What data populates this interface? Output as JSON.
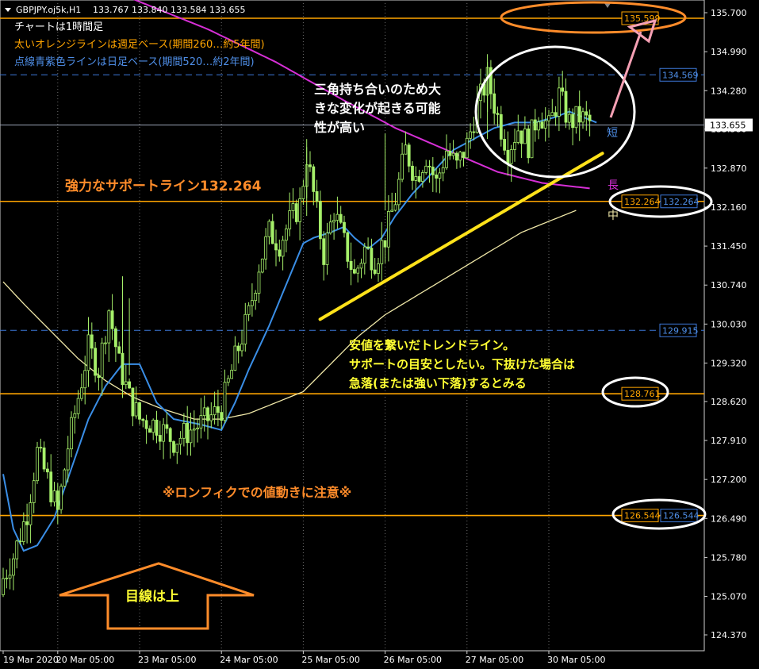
{
  "header": {
    "symbol": "GBPJPY.oj5k,H1",
    "ohlc": "133.767 133.840 133.584 133.655",
    "line1": "チャートは1時間足",
    "line2": "太いオレンジラインは週足ベース(期間260…約5年間)",
    "line3": "点線青紫色ラインは日足ベース(期間520…約2年間)"
  },
  "annotations": {
    "support": "強力なサポートライン132.264",
    "triangle": [
      "三角持ち合いのため大",
      "きな変化が起きる可能",
      "性が高い"
    ],
    "trend": [
      "安値を繋いだトレンドライン。",
      "サポートの目安としたい。下抜けた場合は",
      "急落(または強い下落)するとみる"
    ],
    "lonfix": "※ロンフィクでの値動きに注意※",
    "arrow": "目線は上",
    "ma_short": "短",
    "ma_long": "長",
    "ma_mid": "中"
  },
  "colors": {
    "background": "#000000",
    "orange": "#FFA500",
    "annotation_orange": "#FF8C2A",
    "dashed_blue": "#3C78D8",
    "candle": "#A6F06A",
    "ma_short": "#3A8EE6",
    "ma_mid": "#F0E8A8",
    "ma_long": "#D62FD6",
    "trendline": "#FFE21A",
    "text_yellow": "#FFFF33",
    "pink_arrow": "#F5A0B4",
    "circle_white": "#FFFFFF",
    "axis_text": "#FFFFFF",
    "current_price_bg": "#FFFFFF"
  },
  "chart_data": {
    "type": "candlestick",
    "timeframe": "H1",
    "y_axis": {
      "min": 124.0,
      "max": 135.8,
      "ticks": [
        124.37,
        125.07,
        125.78,
        126.49,
        127.2,
        127.91,
        128.62,
        129.32,
        130.03,
        130.74,
        131.45,
        132.16,
        132.87,
        133.58,
        134.28,
        134.99,
        135.7
      ],
      "tick_labels": [
        "124.370",
        "125.070",
        "125.780",
        "126.490",
        "127.200",
        "127.910",
        "128.620",
        "129.320",
        "130.030",
        "130.740",
        "131.450",
        "132.160",
        "132.870",
        "133.580",
        "134.280",
        "134.990",
        "135.700"
      ]
    },
    "x_axis": {
      "labels": [
        "19 Mar 2020",
        "20 Mar 05:00",
        "23 Mar 05:00",
        "24 Mar 05:00",
        "25 Mar 05:00",
        "26 Mar 05:00",
        "27 Mar 05:00",
        "30 Mar 05:00"
      ],
      "label_index": [
        0,
        16,
        40,
        64,
        88,
        112,
        136,
        160
      ]
    },
    "bar_count": 190,
    "current_price": 133.655,
    "current_price_label": "133.655",
    "horizontal_lines": [
      {
        "value": 135.599,
        "label": "135.599",
        "style": "solid",
        "color": "orange"
      },
      {
        "value": 134.569,
        "label": "134.569",
        "style": "dashed",
        "color": "blue"
      },
      {
        "value": 132.264,
        "label": "132.264",
        "style": "solid",
        "color": "orange"
      },
      {
        "value": 129.915,
        "label": "129.915",
        "style": "dashed",
        "color": "blue"
      },
      {
        "value": 128.761,
        "label": "128.761",
        "style": "solid",
        "color": "orange"
      },
      {
        "value": 126.544,
        "label": "126.544",
        "style": "solid",
        "color": "orange"
      }
    ],
    "price_tags": [
      {
        "value": 135.599,
        "text": "135.599",
        "kind": "orange"
      },
      {
        "value": 134.569,
        "text": "134.569",
        "kind": "blue"
      },
      {
        "value": 132.264,
        "text": "132.264",
        "kind": "orange"
      },
      {
        "value": 132.264,
        "text": "132.264",
        "kind": "blue-axis"
      },
      {
        "value": 129.915,
        "text": "129.915",
        "kind": "blue"
      },
      {
        "value": 128.761,
        "text": "128.761",
        "kind": "orange"
      },
      {
        "value": 126.544,
        "text": "126.544",
        "kind": "orange"
      },
      {
        "value": 126.544,
        "text": "126.544",
        "kind": "blue-axis"
      }
    ],
    "closes_anchor": [
      [
        0,
        125.4
      ],
      [
        3,
        125.8
      ],
      [
        7,
        126.6
      ],
      [
        10,
        127.7
      ],
      [
        13,
        127.2
      ],
      [
        16,
        126.6
      ],
      [
        19,
        127.8
      ],
      [
        22,
        128.7
      ],
      [
        25,
        129.6
      ],
      [
        28,
        129.2
      ],
      [
        31,
        130.3
      ],
      [
        34,
        129.3
      ],
      [
        37,
        128.7
      ],
      [
        40,
        128.3
      ],
      [
        45,
        128.2
      ],
      [
        50,
        127.9
      ],
      [
        55,
        128.1
      ],
      [
        60,
        128.3
      ],
      [
        64,
        128.5
      ],
      [
        68,
        129.4
      ],
      [
        72,
        130.2
      ],
      [
        75,
        131.1
      ],
      [
        78,
        131.7
      ],
      [
        81,
        131.5
      ],
      [
        84,
        131.9
      ],
      [
        87,
        132.2
      ],
      [
        89,
        133.1
      ],
      [
        91,
        132.4
      ],
      [
        94,
        131.3
      ],
      [
        97,
        132.1
      ],
      [
        100,
        131.5
      ],
      [
        103,
        130.9
      ],
      [
        106,
        131.4
      ],
      [
        109,
        131.2
      ],
      [
        112,
        131.6
      ],
      [
        115,
        132.3
      ],
      [
        118,
        133.2
      ],
      [
        121,
        132.7
      ],
      [
        124,
        133.1
      ],
      [
        127,
        132.6
      ],
      [
        130,
        133.2
      ],
      [
        133,
        132.9
      ],
      [
        136,
        133.3
      ],
      [
        139,
        134.0
      ],
      [
        142,
        134.5
      ],
      [
        145,
        133.8
      ],
      [
        148,
        133.2
      ],
      [
        151,
        133.6
      ],
      [
        154,
        133.3
      ],
      [
        157,
        133.9
      ],
      [
        160,
        133.6
      ],
      [
        163,
        134.2
      ],
      [
        166,
        133.7
      ],
      [
        169,
        133.8
      ],
      [
        172,
        133.7
      ]
    ],
    "ma_short": [
      [
        0,
        127.3
      ],
      [
        3,
        126.3
      ],
      [
        6,
        125.9
      ],
      [
        10,
        126.0
      ],
      [
        15,
        126.5
      ],
      [
        20,
        127.4
      ],
      [
        25,
        128.3
      ],
      [
        30,
        128.9
      ],
      [
        35,
        129.3
      ],
      [
        40,
        129.3
      ],
      [
        45,
        128.6
      ],
      [
        50,
        128.3
      ],
      [
        58,
        128.2
      ],
      [
        64,
        128.1
      ],
      [
        68,
        128.6
      ],
      [
        72,
        129.2
      ],
      [
        78,
        130.0
      ],
      [
        84,
        130.9
      ],
      [
        88,
        131.5
      ],
      [
        91,
        131.6
      ],
      [
        96,
        131.7
      ],
      [
        100,
        131.8
      ],
      [
        103,
        131.6
      ],
      [
        107,
        131.4
      ],
      [
        111,
        131.6
      ],
      [
        115,
        132.0
      ],
      [
        120,
        132.4
      ],
      [
        126,
        132.8
      ],
      [
        132,
        133.2
      ],
      [
        138,
        133.4
      ],
      [
        144,
        133.6
      ],
      [
        150,
        133.7
      ],
      [
        156,
        133.7
      ],
      [
        162,
        133.8
      ],
      [
        166,
        133.9
      ],
      [
        170,
        133.8
      ],
      [
        174,
        133.7
      ]
    ],
    "ma_mid": [
      [
        0,
        130.8
      ],
      [
        6,
        130.4
      ],
      [
        14,
        129.9
      ],
      [
        22,
        129.4
      ],
      [
        30,
        129.0
      ],
      [
        38,
        128.7
      ],
      [
        46,
        128.5
      ],
      [
        56,
        128.3
      ],
      [
        64,
        128.3
      ],
      [
        72,
        128.4
      ],
      [
        80,
        128.6
      ],
      [
        88,
        128.8
      ],
      [
        96,
        129.3
      ],
      [
        104,
        129.8
      ],
      [
        112,
        130.2
      ],
      [
        120,
        130.5
      ],
      [
        128,
        130.8
      ],
      [
        136,
        131.1
      ],
      [
        144,
        131.4
      ],
      [
        152,
        131.7
      ],
      [
        160,
        131.9
      ],
      [
        168,
        132.1
      ]
    ],
    "ma_long": [
      [
        36,
        136.0
      ],
      [
        60,
        135.4
      ],
      [
        80,
        134.8
      ],
      [
        100,
        134.1
      ],
      [
        115,
        133.6
      ],
      [
        130,
        133.2
      ],
      [
        145,
        132.8
      ],
      [
        158,
        132.6
      ],
      [
        172,
        132.5
      ]
    ],
    "trendline": {
      "from": [
        92,
        129.9
      ],
      "to": [
        172,
        133.5
      ]
    }
  }
}
